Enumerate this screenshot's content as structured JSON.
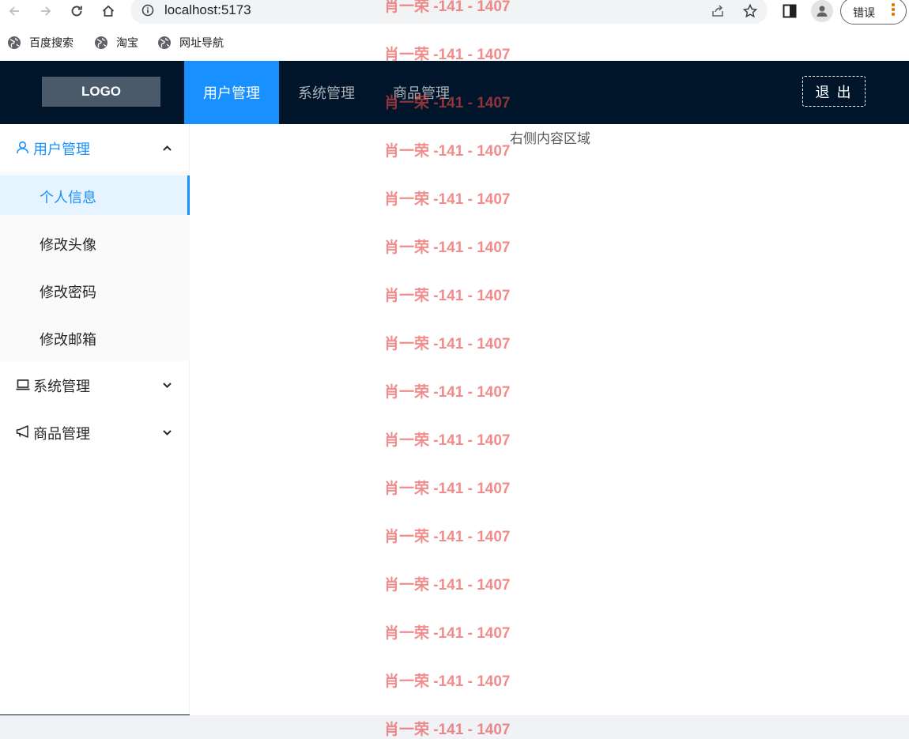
{
  "browser": {
    "url": "localhost:5173",
    "error_label": "错误",
    "bookmarks": [
      "百度搜索",
      "淘宝",
      "网址导航"
    ]
  },
  "header": {
    "logo": "LOGO",
    "tabs": [
      "用户管理",
      "系统管理",
      "商品管理"
    ],
    "active_tab": "用户管理",
    "logout": "退 出"
  },
  "sidebar": {
    "groups": [
      {
        "label": "用户管理",
        "icon": "user-icon",
        "expanded": true,
        "items": [
          "个人信息",
          "修改头像",
          "修改密码",
          "修改邮箱"
        ],
        "active_item": "个人信息"
      },
      {
        "label": "系统管理",
        "icon": "laptop-icon",
        "expanded": false
      },
      {
        "label": "商品管理",
        "icon": "megaphone-icon",
        "expanded": false
      }
    ]
  },
  "main": {
    "placeholder": "右侧内容区域"
  },
  "watermark": "肖一荣 -141 - 1407",
  "colors": {
    "accent": "#1890ff",
    "header_bg": "#001529",
    "active_sub_bg": "#e6f4ff",
    "watermark": "#e84646"
  }
}
